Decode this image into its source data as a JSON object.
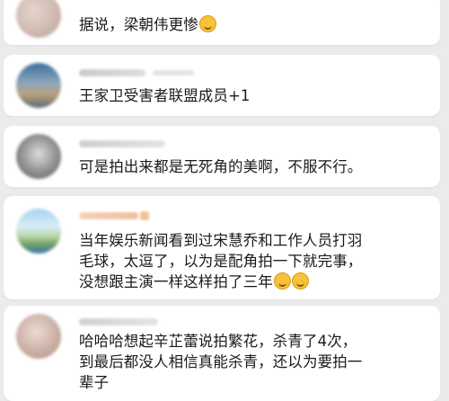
{
  "comments": [
    {
      "text": "据说，梁朝伟更惨",
      "emoji": [
        "grin-sweat-emoji"
      ],
      "avatar_color": "#cdb9b0"
    },
    {
      "text": "王家卫受害者联盟成员+1",
      "emoji": [],
      "avatar_color": "#6b7e93"
    },
    {
      "text": "可是拍出来都是无死角的美啊，不服不行。",
      "emoji": [],
      "avatar_color": "#9a9a9a"
    },
    {
      "lines": [
        "当年娱乐新闻看到过宋慧乔和工作人员打羽",
        "毛球，太逗了，以为是配角拍一下就完事，",
        "没想跟主演一样这样拍了三年"
      ],
      "emoji": [
        "laughing-emoji",
        "laughing-emoji"
      ],
      "avatar_color": "#8cbad8"
    },
    {
      "lines": [
        "哈哈哈想起辛芷蕾说拍繁花，杀青了4次，",
        "到最后都没人相信真能杀青，还以为要拍一",
        "辈子"
      ],
      "emoji": [],
      "avatar_color": "#d6c1b7"
    }
  ]
}
